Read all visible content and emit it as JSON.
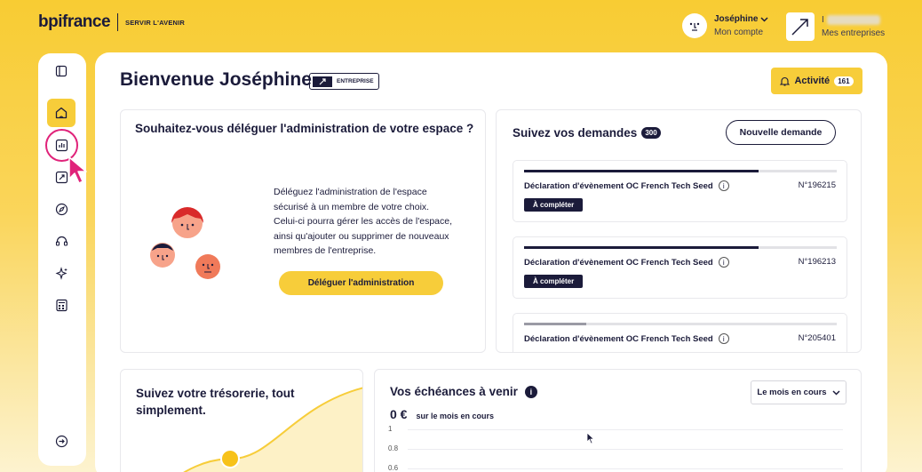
{
  "header": {
    "brand": "bpifrance",
    "tagline": "SERVIR L'AVENIR",
    "user_name": "Joséphine",
    "user_sub": "Mon compte",
    "company_initial": "I",
    "company_sub": "Mes entreprises"
  },
  "sidebar": {
    "items": [
      {
        "name": "home",
        "icon": "home-icon",
        "active": true
      },
      {
        "name": "dashboard",
        "icon": "chart-icon",
        "active": false,
        "highlighted": true
      },
      {
        "name": "rocket",
        "icon": "rocket-icon",
        "active": false
      },
      {
        "name": "compass",
        "icon": "compass-icon",
        "active": false
      },
      {
        "name": "support",
        "icon": "headset-icon",
        "active": false
      },
      {
        "name": "sparkles",
        "icon": "sparkles-icon",
        "active": false
      },
      {
        "name": "calculator",
        "icon": "calculator-icon",
        "active": false
      }
    ]
  },
  "page": {
    "title": "Bienvenue Joséphine",
    "badge": "ENTREPRISE",
    "activity_label": "Activité",
    "activity_count": "161"
  },
  "delegate": {
    "title": "Souhaitez-vous déléguer l'administration de votre espace ?",
    "text": "Déléguez l'administration de l'espace sécurisé à un membre de votre choix. Celui-ci pourra gérer les accès de l'espace, ainsi qu'ajouter ou supprimer de nouveaux membres de l'entreprise.",
    "button": "Déléguer l'administration"
  },
  "requests": {
    "title": "Suivez vos demandes",
    "count": "300",
    "new_button": "Nouvelle demande",
    "items": [
      {
        "name": "Déclaration d'évènement OC French Tech Seed",
        "number": "N°196215",
        "status": "À compléter",
        "progress": 0.75
      },
      {
        "name": "Déclaration d'évènement OC French Tech Seed",
        "number": "N°196213",
        "status": "À compléter",
        "progress": 0.75
      },
      {
        "name": "Déclaration d'évènement OC French Tech Seed",
        "number": "N°205401",
        "status": "",
        "progress": 0.2
      }
    ]
  },
  "treasury": {
    "title": "Suivez votre trésorerie, tout simplement."
  },
  "deadlines": {
    "title": "Vos échéances à venir",
    "select_value": "Le mois en cours",
    "amount": "0 €",
    "amount_sub": "sur le mois en cours",
    "y_ticks": [
      "1",
      "0.8",
      "0.6"
    ]
  },
  "colors": {
    "brand_yellow": "#f7cd3a",
    "navy": "#1b1b3a",
    "highlight_pink": "#e0237a"
  }
}
